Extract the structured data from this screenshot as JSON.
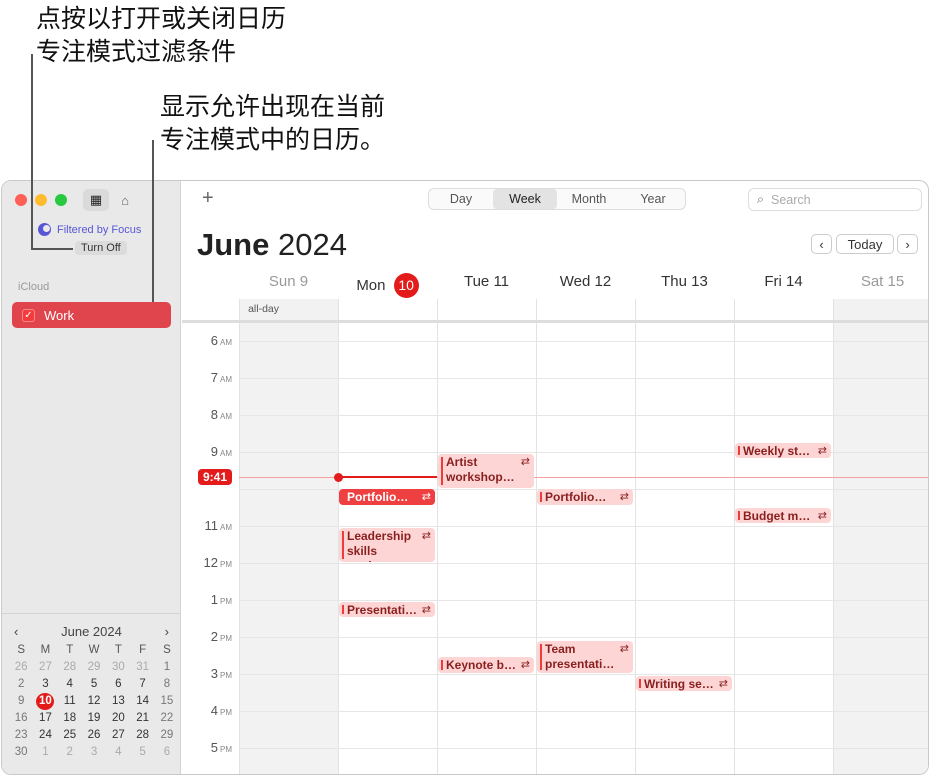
{
  "callouts": [
    "点按以打开或关闭日历\n专注模式过滤条件",
    "显示允许出现在当前\n专注模式中的日历。"
  ],
  "sidebar": {
    "focus_label": "Filtered by Focus",
    "turn_off": "Turn Off",
    "group": "iCloud",
    "calendars": [
      {
        "name": "Work",
        "checked": true,
        "color": "#e0444c"
      }
    ],
    "mini_calendar": {
      "month": "June 2024",
      "weekdays": [
        "S",
        "M",
        "T",
        "W",
        "T",
        "F",
        "S"
      ],
      "weeks": [
        [
          "26",
          "27",
          "28",
          "29",
          "30",
          "31",
          "1"
        ],
        [
          "2",
          "3",
          "4",
          "5",
          "6",
          "7",
          "8"
        ],
        [
          "9",
          "10",
          "11",
          "12",
          "13",
          "14",
          "15"
        ],
        [
          "16",
          "17",
          "18",
          "19",
          "20",
          "21",
          "22"
        ],
        [
          "23",
          "24",
          "25",
          "26",
          "27",
          "28",
          "29"
        ],
        [
          "30",
          "1",
          "2",
          "3",
          "4",
          "5",
          "6"
        ]
      ],
      "today": "10"
    }
  },
  "toolbar": {
    "views": [
      "Day",
      "Week",
      "Month",
      "Year"
    ],
    "selected_view": "Week",
    "search_placeholder": "Search",
    "today": "Today"
  },
  "header": {
    "month": "June",
    "year": "2024"
  },
  "days": [
    {
      "name": "Sun",
      "num": "9",
      "weekend": true
    },
    {
      "name": "Mon",
      "num": "10",
      "today": true
    },
    {
      "name": "Tue",
      "num": "11"
    },
    {
      "name": "Wed",
      "num": "12"
    },
    {
      "name": "Thu",
      "num": "13"
    },
    {
      "name": "Fri",
      "num": "14"
    },
    {
      "name": "Sat",
      "num": "15",
      "weekend": true
    }
  ],
  "allday_label": "all-day",
  "hours": [
    {
      "h": "6",
      "ap": "AM"
    },
    {
      "h": "7",
      "ap": "AM"
    },
    {
      "h": "8",
      "ap": "AM"
    },
    {
      "h": "9",
      "ap": "AM"
    },
    {
      "h": "10",
      "ap": "AM"
    },
    {
      "h": "11",
      "ap": "AM"
    },
    {
      "h": "12",
      "ap": "PM"
    },
    {
      "h": "1",
      "ap": "PM"
    },
    {
      "h": "2",
      "ap": "PM"
    },
    {
      "h": "3",
      "ap": "PM"
    },
    {
      "h": "4",
      "ap": "PM"
    },
    {
      "h": "5",
      "ap": "PM"
    }
  ],
  "now": {
    "label": "9:41",
    "hour": 9.683,
    "day": 1
  },
  "accent": "#e31b1b",
  "events": [
    {
      "title": "Weekly st…",
      "day": 5,
      "start": 8.75,
      "end": 9.2,
      "repeat": true
    },
    {
      "title": "Artist\nworkshop…",
      "day": 2,
      "start": 9.05,
      "end": 10,
      "repeat": true
    },
    {
      "title": "Portfolio…",
      "day": 1,
      "start": 10,
      "end": 10.45,
      "repeat": true,
      "selected": true
    },
    {
      "title": "Portfolio…",
      "day": 3,
      "start": 10,
      "end": 10.45,
      "repeat": true
    },
    {
      "title": "Budget m…",
      "day": 5,
      "start": 10.5,
      "end": 10.95,
      "repeat": true
    },
    {
      "title": "Leadership\nskills work…",
      "day": 1,
      "start": 11.05,
      "end": 12,
      "repeat": true
    },
    {
      "title": "Presentati…",
      "day": 1,
      "start": 13.05,
      "end": 13.5,
      "repeat": true
    },
    {
      "title": "Keynote b…",
      "day": 2,
      "start": 14.55,
      "end": 15,
      "repeat": true
    },
    {
      "title": "Team\npresentati…",
      "day": 3,
      "start": 14.1,
      "end": 15,
      "repeat": true
    },
    {
      "title": "Writing se…",
      "day": 4,
      "start": 15.05,
      "end": 15.5,
      "repeat": true
    }
  ]
}
